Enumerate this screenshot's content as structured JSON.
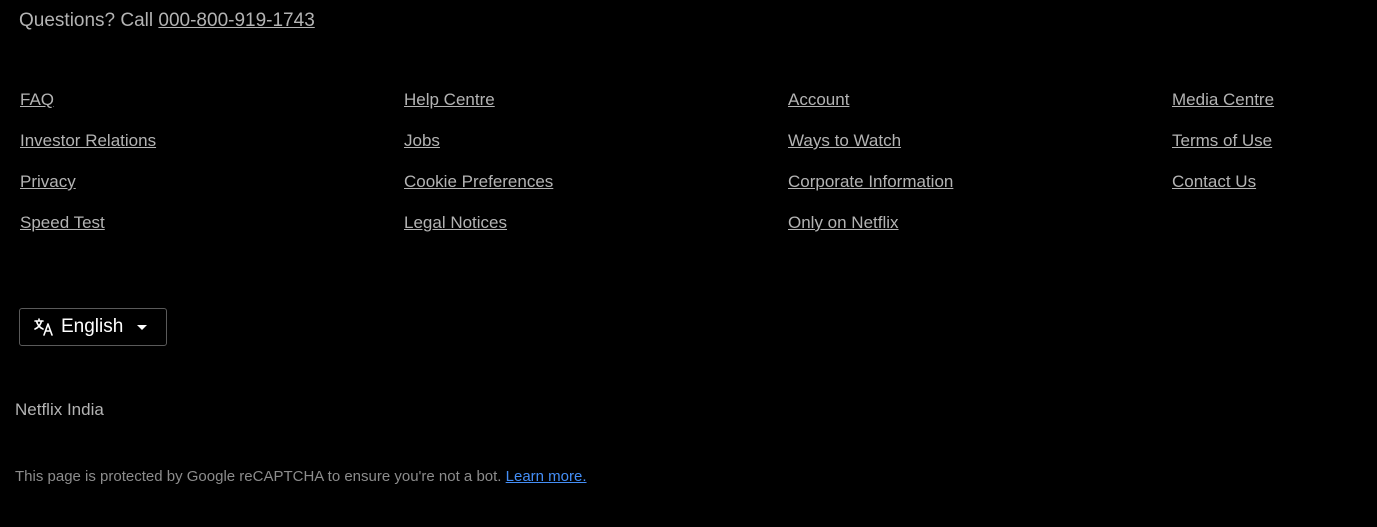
{
  "contact": {
    "prefix": "Questions? Call ",
    "phone": "000-800-919-1743"
  },
  "footer_links": {
    "col1": [
      "FAQ",
      "Investor Relations",
      "Privacy",
      "Speed Test"
    ],
    "col2": [
      "Help Centre",
      "Jobs",
      "Cookie Preferences",
      "Legal Notices"
    ],
    "col3": [
      "Account",
      "Ways to Watch",
      "Corporate Information",
      "Only on Netflix"
    ],
    "col4": [
      "Media Centre",
      "Terms of Use",
      "Contact Us"
    ]
  },
  "language": {
    "selected": "English",
    "icon": "language-icon"
  },
  "country": "Netflix India",
  "recaptcha": {
    "text": "This page is protected by Google reCAPTCHA to ensure you're not a bot. ",
    "link": "Learn more."
  },
  "colors": {
    "background": "#000000",
    "text": "#b3b3b3",
    "link_blue": "#448ef6"
  }
}
